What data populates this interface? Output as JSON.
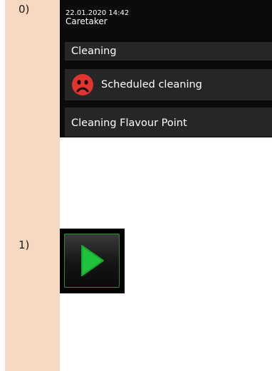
{
  "steps": [
    {
      "label": "0)"
    },
    {
      "label": "1)"
    }
  ],
  "device": {
    "timestamp": "22.01.2020 14:42",
    "user": "Caretaker",
    "menu_title": "Cleaning",
    "items": [
      {
        "label": "Scheduled cleaning",
        "icon": "sad-face-icon",
        "status_color": "#e0342f"
      },
      {
        "label": "Cleaning Flavour Point"
      }
    ]
  },
  "play_button": {
    "icon": "play-icon",
    "accent": "#1fc23b",
    "border": "#2e8a3c"
  }
}
